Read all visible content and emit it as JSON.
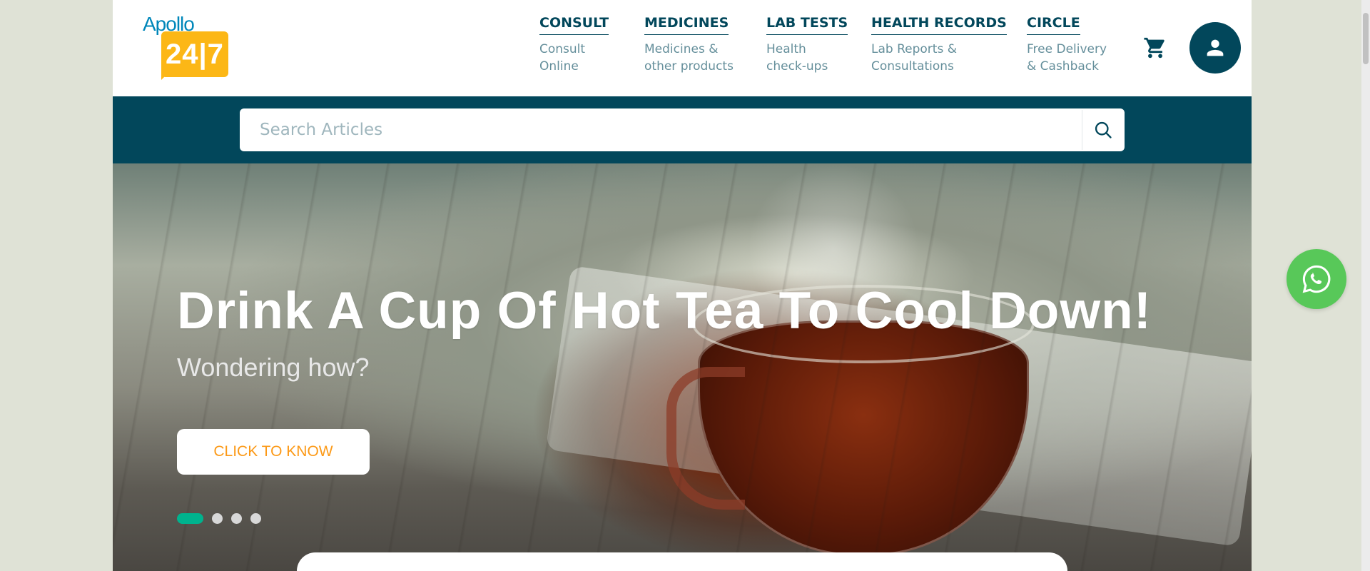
{
  "brand": {
    "word": "Apollo",
    "number": "24|7"
  },
  "nav": [
    {
      "title": "CONSULT",
      "sub": "Consult\nOnline"
    },
    {
      "title": "MEDICINES",
      "sub": "Medicines &\nother products"
    },
    {
      "title": "LAB TESTS",
      "sub": "Health\ncheck-ups"
    },
    {
      "title": "HEALTH RECORDS",
      "sub": "Lab Reports &\nConsultations"
    },
    {
      "title": "CIRCLE",
      "sub": "Free Delivery\n& Cashback"
    }
  ],
  "icons": {
    "cart": "cart-icon",
    "user": "user-icon",
    "search": "search-icon",
    "whatsapp": "whatsapp-icon"
  },
  "search": {
    "placeholder": "Search Articles",
    "value": ""
  },
  "hero": {
    "title": "Drink A Cup Of Hot Tea To Cool Down!",
    "subtitle": "Wondering how?",
    "cta": "CLICK TO KNOW",
    "slides_count": 4,
    "active_slide": 1
  },
  "colors": {
    "primary": "#02475b",
    "accent": "#fc9916",
    "logo_blue": "#0087ba",
    "logo_yellow": "#fcb716",
    "active_dot": "#00b38e",
    "whatsapp": "#58c859"
  }
}
